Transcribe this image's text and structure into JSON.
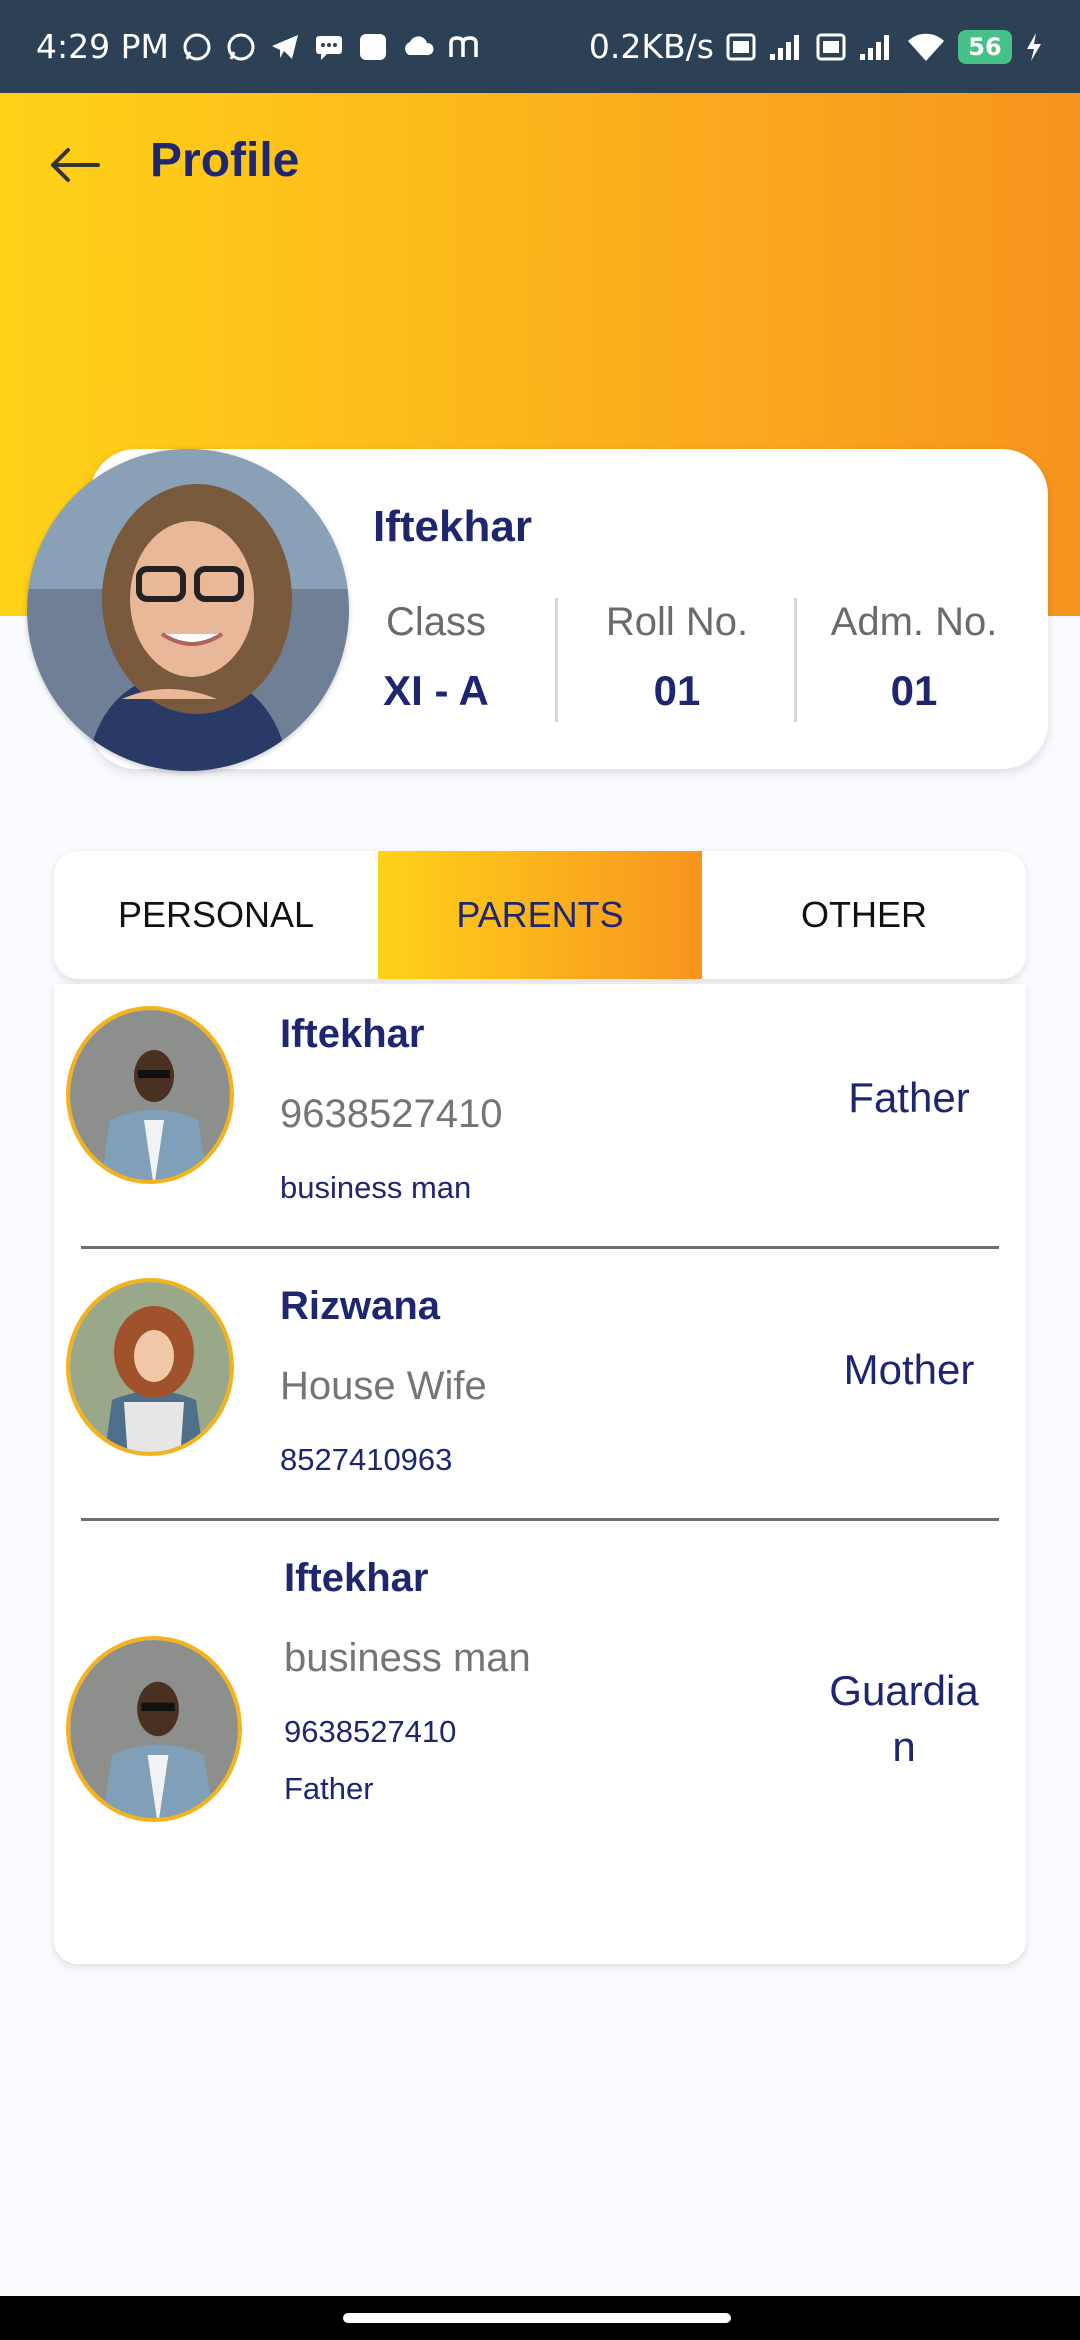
{
  "status_bar": {
    "time": "4:29 PM",
    "network_speed": "0.2KB/s",
    "battery": "56",
    "icons": [
      "whatsapp-icon",
      "whatsapp-icon",
      "telegram-icon",
      "message-icon",
      "app-icon",
      "cloud-icon",
      "m-icon",
      "volte-icon",
      "signal-icon",
      "volte-icon",
      "signal-icon",
      "wifi-icon",
      "charging-icon"
    ]
  },
  "header": {
    "title": "Profile"
  },
  "student": {
    "name": "Iftekhar",
    "stats": [
      {
        "label": "Class",
        "value": "XI - A"
      },
      {
        "label": "Roll No.",
        "value": "01"
      },
      {
        "label": "Adm. No.",
        "value": "01"
      }
    ]
  },
  "tabs": [
    {
      "label": "PERSONAL",
      "active": false
    },
    {
      "label": "PARENTS",
      "active": true
    },
    {
      "label": "OTHER",
      "active": false
    }
  ],
  "parents": [
    {
      "name": "Iftekhar",
      "line2": "9638527410",
      "line3": "business man",
      "line4": "",
      "relation": "Father"
    },
    {
      "name": "Rizwana",
      "line2": "House Wife",
      "line3": "8527410963",
      "line4": "",
      "relation": "Mother"
    },
    {
      "name": "Iftekhar",
      "line2": "business man",
      "line3": "9638527410",
      "line4": "Father",
      "relation": "Guardia\nn"
    }
  ],
  "colors": {
    "accent_yellow": "#ffd219",
    "accent_orange": "#f7941f",
    "primary_text": "#1f2670",
    "status_bar": "#2c4155"
  }
}
